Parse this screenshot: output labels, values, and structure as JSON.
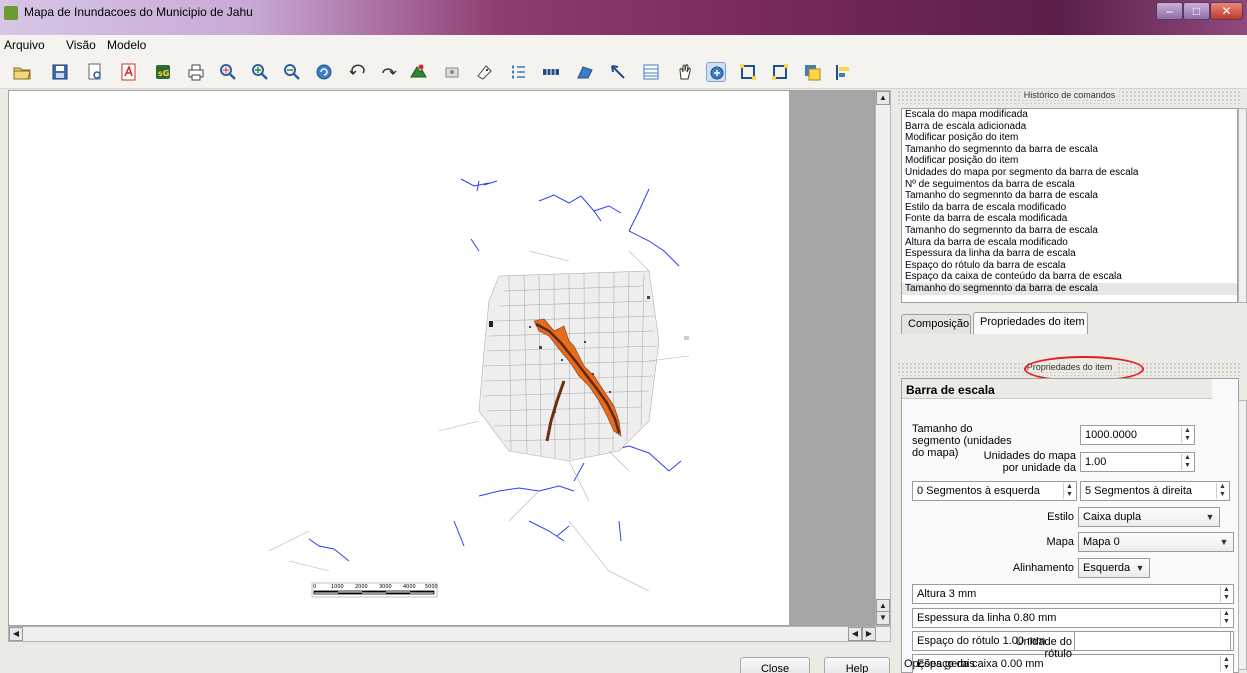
{
  "window": {
    "title": "Mapa de Inundacoes do Municipio de Jahu",
    "min": "–",
    "max": "□",
    "close": "✕"
  },
  "menu": [
    "Arquivo",
    "Visão",
    "Modelo"
  ],
  "toolbar_icons": [
    "open-icon",
    "save-icon",
    "print-preview-icon",
    "pdf-icon",
    "svg-export-icon",
    "print-icon",
    "zoom-full-icon",
    "zoom-in-icon",
    "zoom-out-icon",
    "refresh-icon",
    "undo-icon",
    "redo-icon",
    "add-map-icon",
    "add-image-icon",
    "add-label-icon",
    "add-legend-icon",
    "add-scalebar-icon",
    "add-shape-icon",
    "add-arrow-icon",
    "add-table-icon",
    "pan-icon",
    "move-content-icon",
    "select-move-icon",
    "group-icon",
    "raise-icon",
    "align-icon"
  ],
  "map": {
    "scalebar_labels": [
      "0",
      "1000",
      "2000",
      "3000",
      "4000",
      "5000"
    ]
  },
  "history": {
    "title": "Histórico de comandos",
    "items": [
      "Escala do mapa modificada",
      "Barra de escala adicionada",
      "Modificar posição do item",
      "Tamanho do segmennto da barra de escala",
      "Modificar posição do item",
      "Unidades do mapa por segmento da barra de escala",
      "Nº de seguimentos da barra de escala",
      "Tamanho do segmennto da barra de escala",
      "Estilo da barra de escala modificado",
      "Fonte da barra de escala modificada",
      "Tamanho do segmennto da barra de escala",
      "Altura da barra de escala modificado",
      "Espessura da linha da barra de escala",
      "Espaço do rótulo da barra de escala",
      "Espaço da caixa de conteúdo da barra de escala",
      "Tamanho do segmennto da barra de escala"
    ]
  },
  "tabs": {
    "composition": "Composição",
    "item_properties": "Propriedades do item"
  },
  "item_props": {
    "dock_title": "Propriedades do item",
    "section": "Barra de escala",
    "segment_size_label": "Tamanho do segmento (unidades do mapa)",
    "segment_size_value": "1000.0000",
    "map_units_label": "Unidades do mapa por unidade da",
    "map_units_value": "1.00",
    "left_segments": "0 Segmentos à esquerda",
    "right_segments": "5 Segmentos à direita",
    "style_label": "Estilo",
    "style_value": "Caixa dupla",
    "map_label": "Mapa",
    "map_value": "Mapa 0",
    "alignment_label": "Alinhamento",
    "alignment_value": "Esquerda",
    "height": "Altura 3 mm",
    "line_width": "Espessura da linha 0.80 mm",
    "label_space": "Espaço do rótulo 1.00 mm",
    "box_space": "Espaço da caixa 0.00 mm",
    "label_unit_label": "Unidade do rótulo",
    "label_unit_value": ""
  },
  "general": "Opções gerais",
  "buttons": {
    "close": "Close",
    "help": "Help"
  }
}
